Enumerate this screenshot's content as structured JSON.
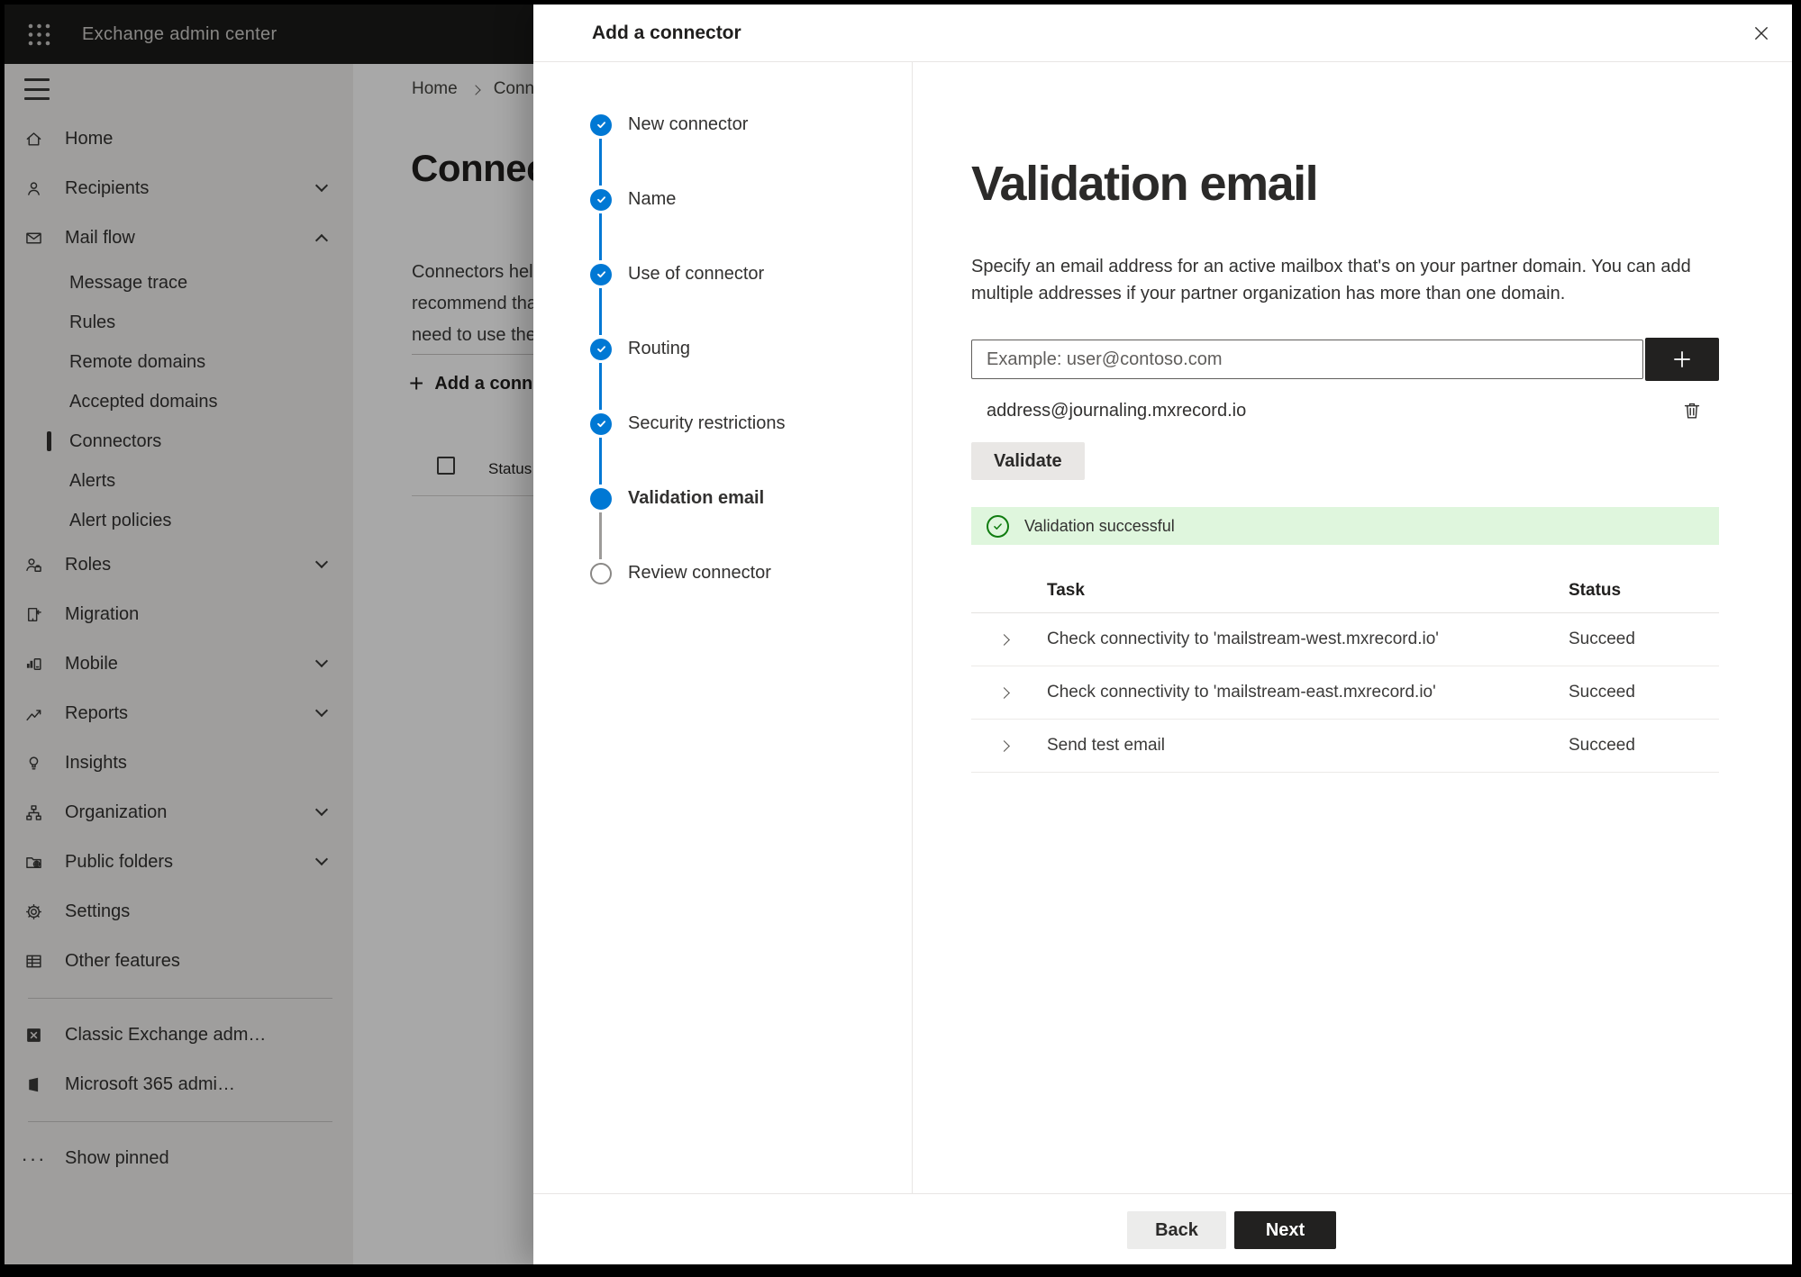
{
  "colors": {
    "accent": "#0078d4",
    "success_bg": "#dff6dd",
    "success_fg": "#107c10",
    "dark_button": "#222120",
    "topbar_bg": "#1b1a19"
  },
  "topbar": {
    "title": "Exchange admin center"
  },
  "sidebar": {
    "items": [
      {
        "label": "Home"
      },
      {
        "label": "Recipients"
      },
      {
        "label": "Mail flow"
      },
      {
        "label": "Message trace"
      },
      {
        "label": "Rules"
      },
      {
        "label": "Remote domains"
      },
      {
        "label": "Accepted domains"
      },
      {
        "label": "Connectors"
      },
      {
        "label": "Alerts"
      },
      {
        "label": "Alert policies"
      },
      {
        "label": "Roles"
      },
      {
        "label": "Migration"
      },
      {
        "label": "Mobile"
      },
      {
        "label": "Reports"
      },
      {
        "label": "Insights"
      },
      {
        "label": "Organization"
      },
      {
        "label": "Public folders"
      },
      {
        "label": "Settings"
      },
      {
        "label": "Other features"
      },
      {
        "label": "Classic Exchange adm…"
      },
      {
        "label": "Microsoft 365 admi…"
      },
      {
        "label": "Show pinned"
      }
    ]
  },
  "background": {
    "breadcrumb": {
      "home": "Home",
      "current": "Conne"
    },
    "heading": "Connect",
    "para_lines": [
      "Connectors help",
      "recommend tha",
      "need to use ther"
    ],
    "add_button": "Add a conn",
    "status_header": "Status"
  },
  "panel": {
    "title": "Add a connector",
    "wizard": {
      "steps": [
        {
          "label": "New connector",
          "state": "done"
        },
        {
          "label": "Name",
          "state": "done"
        },
        {
          "label": "Use of connector",
          "state": "done"
        },
        {
          "label": "Routing",
          "state": "done"
        },
        {
          "label": "Security restrictions",
          "state": "done"
        },
        {
          "label": "Validation email",
          "state": "current"
        },
        {
          "label": "Review connector",
          "state": "todo"
        }
      ]
    },
    "main": {
      "title": "Validation email",
      "description": "Specify an email address for an active mailbox that's on your partner domain. You can add multiple addresses if your partner organization has more than one domain.",
      "input_placeholder": "Example: user@contoso.com",
      "address": "address@journaling.mxrecord.io",
      "validate_label": "Validate",
      "banner_text": "Validation successful",
      "table": {
        "headers": {
          "task": "Task",
          "status": "Status"
        },
        "rows": [
          {
            "task": "Check connectivity to 'mailstream-west.mxrecord.io'",
            "status": "Succeed"
          },
          {
            "task": "Check connectivity to 'mailstream-east.mxrecord.io'",
            "status": "Succeed"
          },
          {
            "task": "Send test email",
            "status": "Succeed"
          }
        ]
      }
    },
    "footer": {
      "back": "Back",
      "next": "Next"
    }
  }
}
